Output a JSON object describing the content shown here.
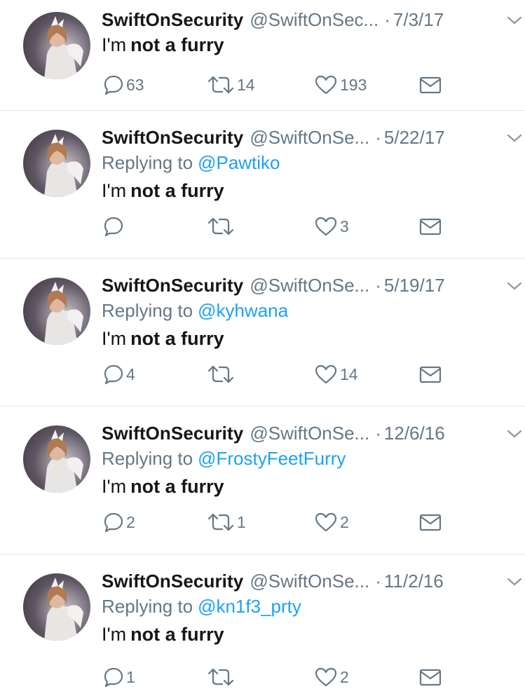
{
  "tweets": [
    {
      "name": "SwiftOnSecurity",
      "handle": "@SwiftOnSec...",
      "date": "7/3/17",
      "replying_label": "",
      "replying_to": "",
      "text_prefix": "I'm",
      "text_bold": "not a furry",
      "replies": "63",
      "retweets": "14",
      "likes": "193"
    },
    {
      "name": "SwiftOnSecurity",
      "handle": "@SwiftOnSe...",
      "date": "5/22/17",
      "replying_label": "Replying to",
      "replying_to": "@Pawtiko",
      "text_prefix": "I'm",
      "text_bold": "not a furry",
      "replies": "",
      "retweets": "",
      "likes": "3"
    },
    {
      "name": "SwiftOnSecurity",
      "handle": "@SwiftOnSe...",
      "date": "5/19/17",
      "replying_label": "Replying to",
      "replying_to": "@kyhwana",
      "text_prefix": "I'm",
      "text_bold": "not a furry",
      "replies": "4",
      "retweets": "",
      "likes": "14"
    },
    {
      "name": "SwiftOnSecurity",
      "handle": "@SwiftOnSe...",
      "date": "12/6/16",
      "replying_label": "Replying to",
      "replying_to": "@FrostyFeetFurry",
      "text_prefix": "I'm",
      "text_bold": "not a furry",
      "replies": "2",
      "retweets": "1",
      "likes": "2"
    },
    {
      "name": "SwiftOnSecurity",
      "handle": "@SwiftOnSe...",
      "date": "11/2/16",
      "replying_label": "Replying to",
      "replying_to": "@kn1f3_prty",
      "text_prefix": "I'm",
      "text_bold": "not a furry",
      "replies": "1",
      "retweets": "",
      "likes": "2"
    }
  ],
  "dot": "·",
  "icons": {
    "reply": "reply-icon",
    "retweet": "retweet-icon",
    "like": "heart-icon",
    "dm": "envelope-icon",
    "caret": "chevron-down-icon"
  },
  "colors": {
    "link": "#1da1f2",
    "muted": "#657786",
    "text": "#14171a",
    "divider": "#e1e8ed"
  }
}
